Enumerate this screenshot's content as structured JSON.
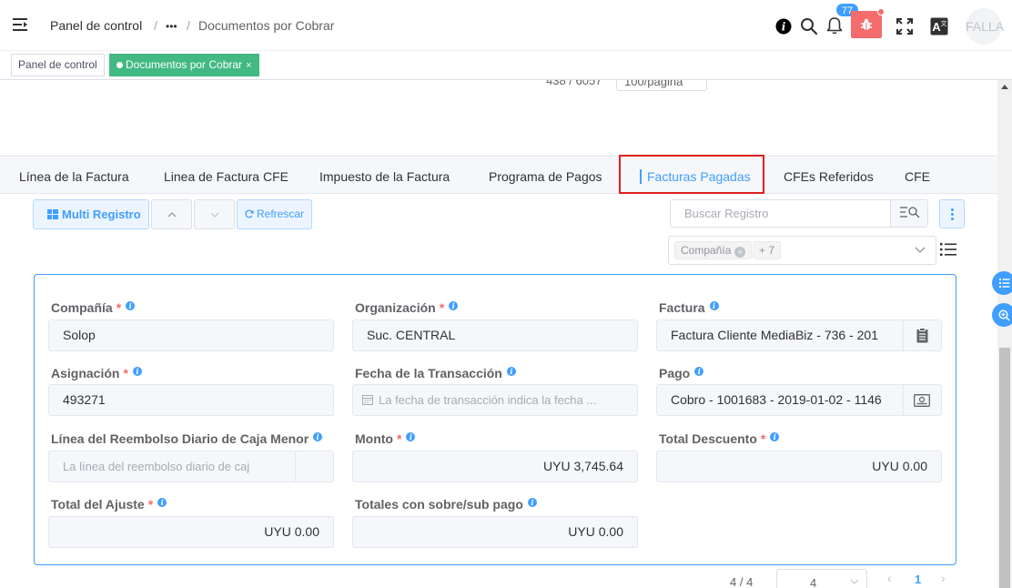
{
  "header": {
    "breadcrumb": [
      "Panel de control",
      "•••",
      "Documentos por Cobrar"
    ],
    "separator": "/",
    "notification_count": "77",
    "avatar_text": "FALLA"
  },
  "tags_view": {
    "tags": [
      {
        "label": "Panel de control",
        "active": false
      },
      {
        "label": "Documentos por Cobrar",
        "active": true,
        "close": "×"
      }
    ]
  },
  "top_pagination": {
    "range_text": "438 / 6057",
    "page_size": "100/página"
  },
  "tabs": [
    {
      "label": "Línea de la Factura"
    },
    {
      "label": "Linea de Factura CFE"
    },
    {
      "label": "Impuesto de la Factura"
    },
    {
      "label": "Programa de Pagos"
    },
    {
      "label": "Facturas Pagadas",
      "active": true
    },
    {
      "label": "CFEs Referidos"
    },
    {
      "label": "CFE"
    }
  ],
  "toolbar": {
    "multi_record_label": "Multi Registro",
    "refresh_label": "Refrescar",
    "search_placeholder": "Buscar Registro",
    "filter_chip": "Compañía",
    "filter_more": "+ 7"
  },
  "form": {
    "fields": {
      "company": {
        "label": "Compañía",
        "value": "Solop",
        "required": true
      },
      "organization": {
        "label": "Organización",
        "value": "Suc. CENTRAL",
        "required": true
      },
      "invoice": {
        "label": "Factura",
        "value": "Factura Cliente MediaBiz - 736 - 201"
      },
      "allocation": {
        "label": "Asignación",
        "value": "493271",
        "required": true
      },
      "transaction_date": {
        "label": "Fecha de la Transacción",
        "placeholder": "La fecha de transacción indica la fecha ..."
      },
      "payment": {
        "label": "Pago",
        "value": "Cobro - 1001683 - 2019-01-02 - 1146"
      },
      "petty_cash_line": {
        "label": "Línea del Reembolso Diario de Caja Menor",
        "placeholder": "La línea del reembolso diario de caj"
      },
      "amount": {
        "label": "Monto",
        "value": "UYU 3,745.64",
        "required": true
      },
      "discount_total": {
        "label": "Total Descuento",
        "value": "UYU 0.00",
        "required": true
      },
      "adjustment_total": {
        "label": "Total del Ajuste",
        "value": "UYU 0.00",
        "required": true
      },
      "over_under_total": {
        "label": "Totales con sobre/sub pago",
        "value": "UYU 0.00"
      }
    },
    "required_mark": "*",
    "info_mark": "i"
  },
  "bottom_pagination": {
    "range_text": "4 / 4",
    "page_size": "4",
    "current_page": "1",
    "prev": "‹",
    "next": "›"
  },
  "colors": {
    "primary": "#409eff",
    "active_tag": "#42b983",
    "bug_button": "#f56c6c",
    "highlight_box": "#e02020"
  }
}
